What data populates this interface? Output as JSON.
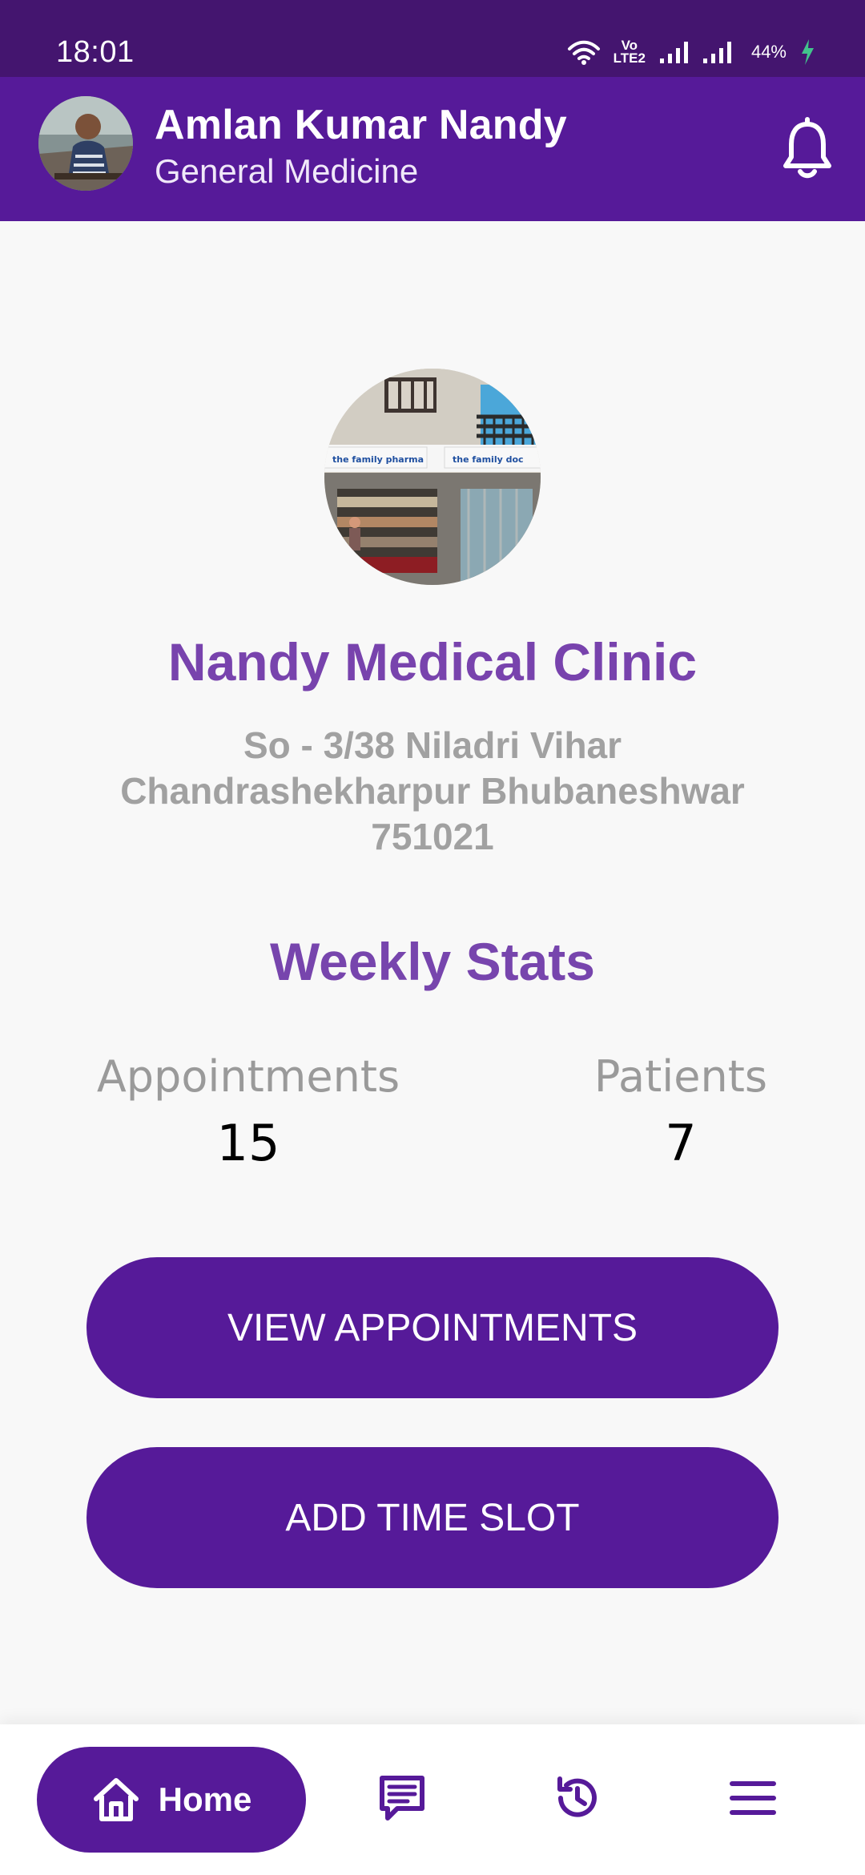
{
  "status_bar": {
    "time": "18:01",
    "battery": "44%",
    "network_label_top": "Vo",
    "network_label_bottom": "LTE2",
    "icons": [
      "wifi-icon",
      "volte-icon",
      "signal-icon",
      "signal-icon",
      "battery-charging-icon"
    ]
  },
  "header": {
    "name": "Amlan Kumar Nandy",
    "specialty": "General Medicine",
    "avatar_icon": "doctor-avatar",
    "notification_icon": "bell-icon"
  },
  "clinic": {
    "name": "Nandy Medical Clinic",
    "address_line1": "So - 3/38 Niladri Vihar",
    "address_line2": "Chandrashekharpur Bhubaneshwar",
    "address_line3": "751021",
    "photo_icon": "clinic-photo",
    "signboard_left": "the family pharma",
    "signboard_right": "the family doc"
  },
  "stats": {
    "title": "Weekly Stats",
    "appointments_label": "Appointments",
    "appointments_value": "15",
    "patients_label": "Patients",
    "patients_value": "7"
  },
  "actions": {
    "view_appointments": "VIEW APPOINTMENTS",
    "add_time_slot": "ADD TIME SLOT"
  },
  "bottom_nav": {
    "home_label": "Home",
    "items": [
      "home-icon",
      "messages-icon",
      "history-icon",
      "menu-icon"
    ]
  },
  "colors": {
    "status_bar": "#44156f",
    "primary": "#561a99",
    "accent_text": "#7843ad",
    "muted_text": "#a1a1a1",
    "background": "#f8f8f8"
  }
}
